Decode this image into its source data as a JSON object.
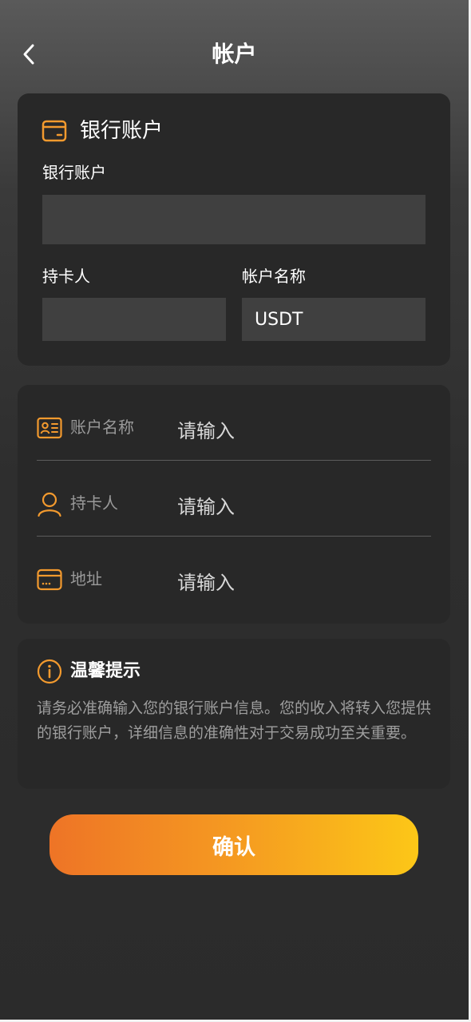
{
  "header": {
    "title": "帐户"
  },
  "bank_card": {
    "title": "银行账户",
    "bank_account_label": "银行账户",
    "bank_account_value": "",
    "holder_label": "持卡人",
    "holder_value": "",
    "account_name_label": "帐户名称",
    "account_name_value": "USDT"
  },
  "form": {
    "rows": [
      {
        "label": "账户名称",
        "placeholder": "请输入",
        "icon": "id-card-icon"
      },
      {
        "label": "持卡人",
        "placeholder": "请输入",
        "icon": "user-icon"
      },
      {
        "label": "地址",
        "placeholder": "请输入",
        "icon": "card-icon"
      }
    ]
  },
  "tips": {
    "title": "温馨提示",
    "text": "请务必准确输入您的银行账户信息。您的收入将转入您提供的银行账户，详细信息的准确性对于交易成功至关重要。"
  },
  "confirm_label": "确认",
  "colors": {
    "accent": "#f39a2e",
    "card_bg": "#282828",
    "input_bg": "#404040",
    "button_gradient_start": "#ee7426",
    "button_gradient_end": "#fcc717"
  }
}
